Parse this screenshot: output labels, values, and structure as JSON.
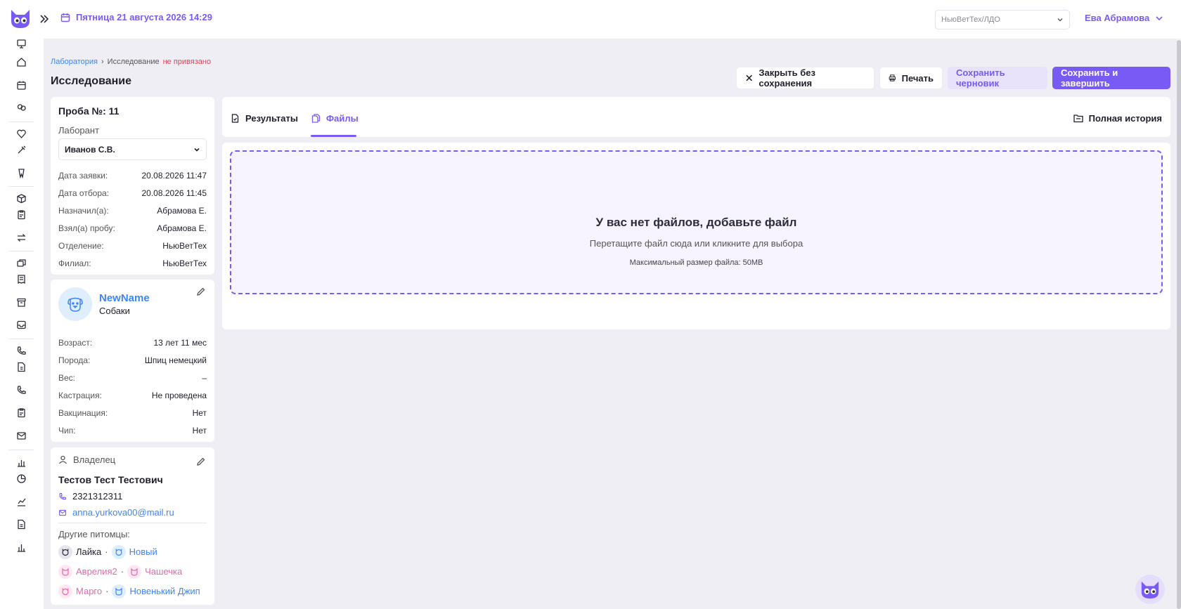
{
  "header": {
    "datetime": "Пятница 21 августа 2026 14:29",
    "branch": "НьюВетТех/ЛДО",
    "user": "Ева Абрамова"
  },
  "breadcrumb": {
    "root": "Лаборатория",
    "separator": "›",
    "current": "Исследование",
    "status": "не привязано"
  },
  "page": {
    "title": "Исследование"
  },
  "actions": {
    "close": "Закрыть без сохранения",
    "print": "Печать",
    "draft": "Сохранить черновик",
    "save": "Сохранить и завершить"
  },
  "sample": {
    "title": "Проба №: 11",
    "lab_label": "Лаборант",
    "lab_value": "Иванов С.В.",
    "fields": [
      {
        "k": "Дата заявки:",
        "v": "20.08.2026 11:47"
      },
      {
        "k": "Дата отбора:",
        "v": "20.08.2026 11:45"
      },
      {
        "k": "Назначил(а):",
        "v": "Абрамова Е."
      },
      {
        "k": "Взял(а) пробу:",
        "v": "Абрамова Е."
      },
      {
        "k": "Отделение:",
        "v": "НьюВетТех"
      },
      {
        "k": "Филиал:",
        "v": "НьюВетТех"
      }
    ]
  },
  "pet": {
    "name": "NewName",
    "species": "Собаки",
    "fields": [
      {
        "k": "Возраст:",
        "v": "13 лет 11 мес"
      },
      {
        "k": "Порода:",
        "v": "Шпиц немецкий"
      },
      {
        "k": "Вес:",
        "v": "–"
      },
      {
        "k": "Кастрация:",
        "v": "Не проведена"
      },
      {
        "k": "Вакцинация:",
        "v": "Нет"
      },
      {
        "k": "Чип:",
        "v": "Нет"
      }
    ]
  },
  "owner": {
    "label": "Владелец",
    "name": "Тестов Тест Тестович",
    "phone": "2321312311",
    "email": "anna.yurkova00@mail.ru",
    "others_label": "Другие питомцы:",
    "others": [
      {
        "name": "Лайка",
        "color": "#1f1f2b"
      },
      {
        "name": "Новый",
        "color": "#3c86f5"
      },
      {
        "name": "Аврелия2",
        "color": "#e46aa8"
      },
      {
        "name": "Чашечка",
        "color": "#e46aa8"
      },
      {
        "name": "Марго",
        "color": "#e46aa8"
      },
      {
        "name": "Новенький Джип",
        "color": "#3c86f5"
      }
    ]
  },
  "tabs": {
    "results": "Результаты",
    "files": "Файлы",
    "history": "Полная история"
  },
  "files": {
    "empty_title": "У вас нет файлов, добавьте файл",
    "hint": "Перетащите файл сюда или кликните для выбора",
    "max_size": "Максимальный размер файла: 50MB"
  },
  "colors": {
    "accent": "#7a5af5",
    "link": "#3c86f5",
    "warning": "#e0455a",
    "pink": "#e46aa8"
  }
}
